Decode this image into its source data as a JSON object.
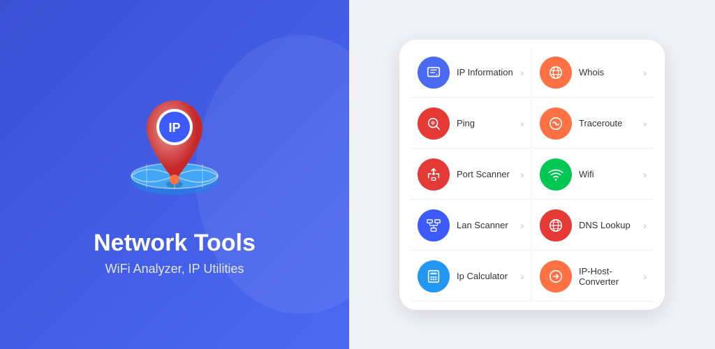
{
  "left": {
    "title": "Network Tools",
    "subtitle": "WiFi Analyzer, IP Utilities"
  },
  "right": {
    "items": [
      {
        "id": "ip-info",
        "label": "IP Information",
        "iconColor": "icon-blue",
        "iconSymbol": "🗺"
      },
      {
        "id": "whois",
        "label": "Whois",
        "iconColor": "icon-orange",
        "iconSymbol": "🌐"
      },
      {
        "id": "ping",
        "label": "Ping",
        "iconColor": "icon-red-dark",
        "iconSymbol": "🔍"
      },
      {
        "id": "traceroute",
        "label": "Traceroute",
        "iconColor": "icon-orange",
        "iconSymbol": "📡"
      },
      {
        "id": "port-scanner",
        "label": "Port Scanner",
        "iconColor": "icon-usb-red",
        "iconSymbol": "⚡"
      },
      {
        "id": "wifi",
        "label": "Wifi",
        "iconColor": "icon-green",
        "iconSymbol": "📶"
      },
      {
        "id": "lan-scanner",
        "label": "Lan Scanner",
        "iconColor": "icon-blue2",
        "iconSymbol": "🖧"
      },
      {
        "id": "dns-lookup",
        "label": "DNS Lookup",
        "iconColor": "icon-red2",
        "iconSymbol": "🌐"
      },
      {
        "id": "ip-calculator",
        "label": "Ip Calculator",
        "iconColor": "icon-blue3",
        "iconSymbol": "🖩"
      },
      {
        "id": "ip-host",
        "label": "IP-Host-Converter",
        "iconColor": "icon-orange2",
        "iconSymbol": "🔄"
      }
    ]
  }
}
